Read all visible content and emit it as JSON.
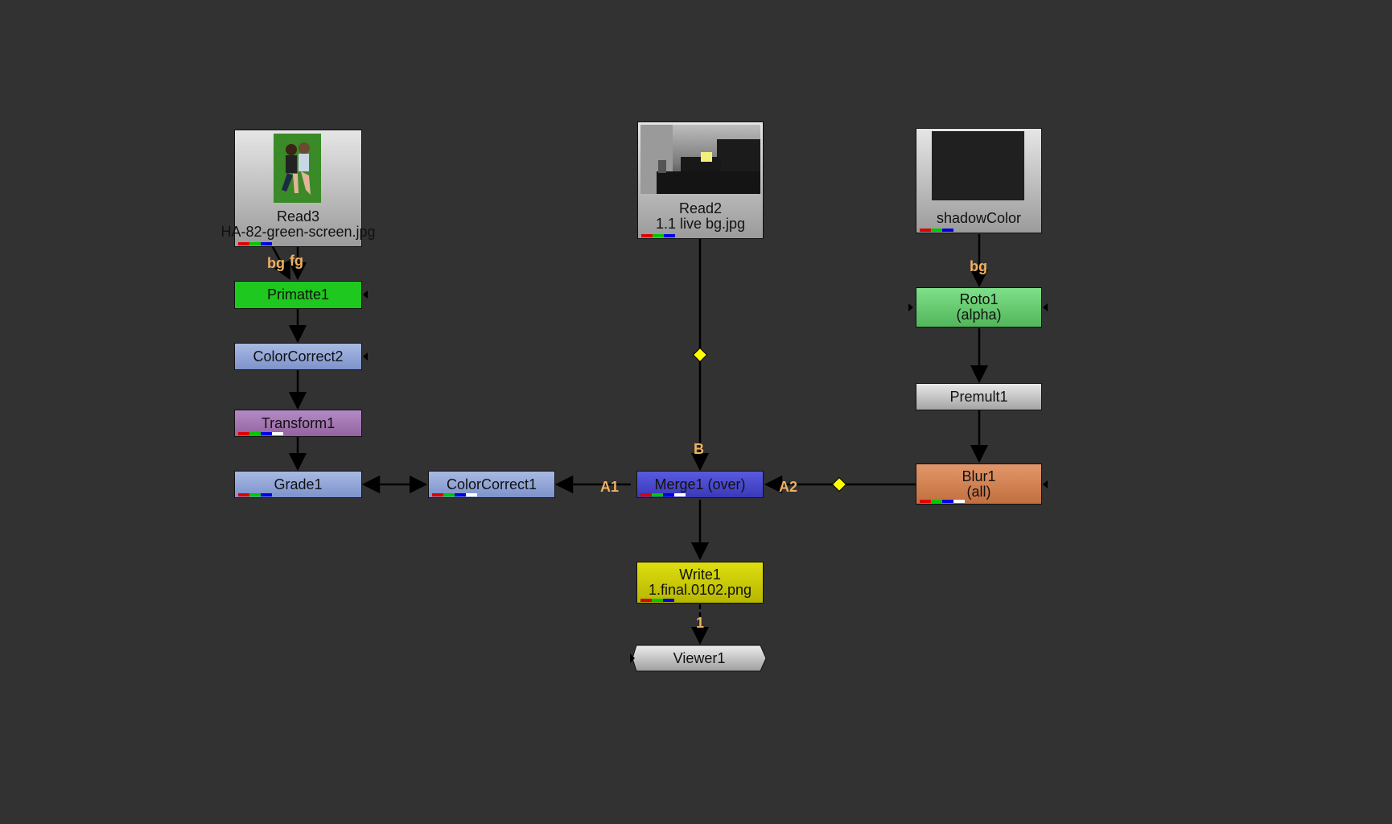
{
  "nodes": {
    "read3": {
      "title": "Read3",
      "file": "HA-82-green-screen.jpg"
    },
    "read2": {
      "title": "Read2",
      "file": "1.1 live bg.jpg"
    },
    "shadow_color": {
      "title": "shadowColor"
    },
    "primatte1": {
      "title": "Primatte1"
    },
    "colorcorrect2": {
      "title": "ColorCorrect2"
    },
    "transform1": {
      "title": "Transform1"
    },
    "grade1": {
      "title": "Grade1"
    },
    "colorcorrect1": {
      "title": "ColorCorrect1"
    },
    "merge1": {
      "title": "Merge1 (over)"
    },
    "roto1": {
      "title": "Roto1",
      "sub": "(alpha)"
    },
    "premult1": {
      "title": "Premult1"
    },
    "blur1": {
      "title": "Blur1",
      "sub": "(all)"
    },
    "write1": {
      "title": "Write1",
      "file": "1.final.0102.png"
    },
    "viewer1": {
      "title": "Viewer1"
    }
  },
  "inputs": {
    "primatte_bg": "bg",
    "primatte_fg": "fg",
    "roto_bg": "bg",
    "merge_b": "B",
    "merge_a1": "A1",
    "merge_a2": "A2",
    "viewer_1": "1"
  },
  "colors": {
    "canvas": "#323232",
    "primatte": "#1ec81e",
    "colorcorrect": "#8aa0d6",
    "transform": "#a276b4",
    "merge": "#4a4ad0",
    "roto": "#6ccf76",
    "blur": "#d58352",
    "write": "#d2d200",
    "input_label": "#f0b060",
    "dot": "#ffff00"
  }
}
